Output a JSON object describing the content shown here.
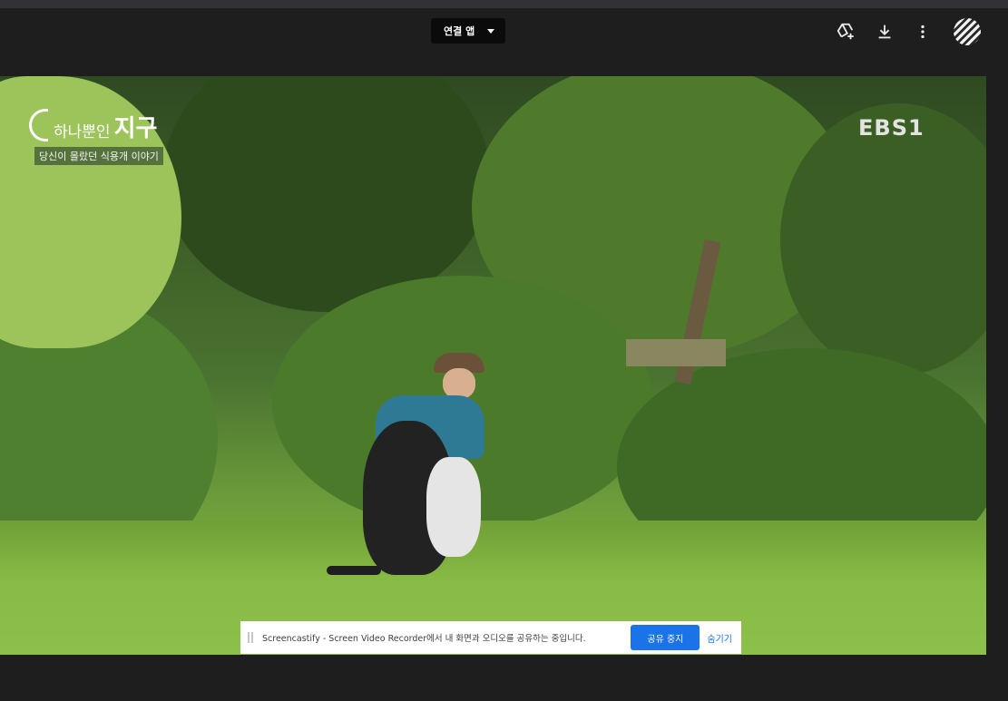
{
  "toolbar": {
    "open_with_label": "연결 앱",
    "icons": [
      "add-to-drive-icon",
      "download-icon",
      "more-vert-icon"
    ],
    "avatar": "account-avatar"
  },
  "video": {
    "program_title_small": "하나뿐인",
    "program_title_big": "지구",
    "program_subtitle": "당신이 몰랐던 식용개 이야기",
    "channel_logo": "EBS1"
  },
  "share_bar": {
    "message": "Screencastify - Screen Video Recorder에서 내 화면과 오디오를 공유하는 중입니다.",
    "stop_label": "공유 중지",
    "hide_label": "숨기기",
    "accent_color": "#1a73e8"
  }
}
